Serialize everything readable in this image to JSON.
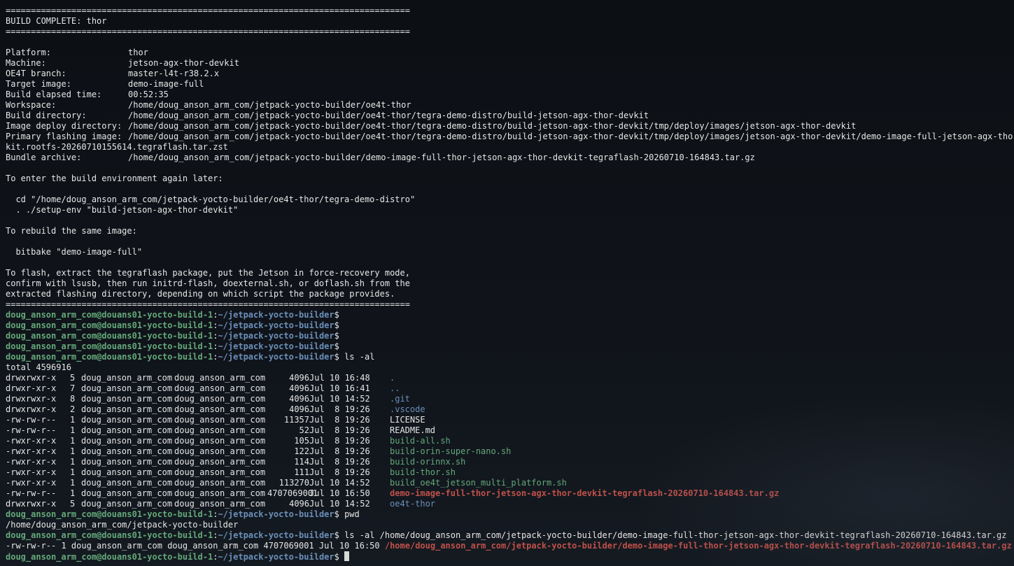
{
  "separator": "================================================================================",
  "build_title": "BUILD COMPLETE: thor",
  "summary": [
    {
      "label": "Platform:",
      "value": "thor"
    },
    {
      "label": "Machine:",
      "value": "jetson-agx-thor-devkit"
    },
    {
      "label": "OE4T branch:",
      "value": "master-l4t-r38.2.x"
    },
    {
      "label": "Target image:",
      "value": "demo-image-full"
    },
    {
      "label": "Build elapsed time:",
      "value": "00:52:35"
    },
    {
      "label": "Workspace:",
      "value": "/home/doug_anson_arm_com/jetpack-yocto-builder/oe4t-thor"
    },
    {
      "label": "Build directory:",
      "value": "/home/doug_anson_arm_com/jetpack-yocto-builder/oe4t-thor/tegra-demo-distro/build-jetson-agx-thor-devkit"
    },
    {
      "label": "Image deploy directory:",
      "value": "/home/doug_anson_arm_com/jetpack-yocto-builder/oe4t-thor/tegra-demo-distro/build-jetson-agx-thor-devkit/tmp/deploy/images/jetson-agx-thor-devkit"
    },
    {
      "label": "Primary flashing image:",
      "value": "/home/doug_anson_arm_com/jetpack-yocto-builder/oe4t-thor/tegra-demo-distro/build-jetson-agx-thor-devkit/tmp/deploy/images/jetson-agx-thor-devkit/demo-image-full-jetson-agx-thor-dev"
    },
    {
      "label": "",
      "value": "kit.rootfs-20260710155614.tegraflash.tar.zst",
      "continuation": true
    },
    {
      "label": "Bundle archive:",
      "value": "/home/doug_anson_arm_com/jetpack-yocto-builder/demo-image-full-thor-jetson-agx-thor-devkit-tegraflash-20260710-164843.tar.gz"
    }
  ],
  "reenter_heading": "To enter the build environment again later:",
  "reenter_cmd1": "  cd \"/home/doug_anson_arm_com/jetpack-yocto-builder/oe4t-thor/tegra-demo-distro\"",
  "reenter_cmd2": "  . ./setup-env \"build-jetson-agx-thor-devkit\"",
  "rebuild_heading": "To rebuild the same image:",
  "rebuild_cmd": "  bitbake \"demo-image-full\"",
  "flash_text": [
    "To flash, extract the tegraflash package, put the Jetson in force-recovery mode,",
    "confirm with lsusb, then run initrd-flash, doexternal.sh, or doflash.sh from the",
    "extracted flashing directory, depending on which script the package provides."
  ],
  "prompt": {
    "user_host": "doug_anson_arm_com@douans01-yocto-build-1",
    "cwd": "~/jetpack-yocto-builder",
    "symbol": "$"
  },
  "ls_cmd": " ls -al",
  "ls_total": "total 4596916",
  "ls_rows": [
    {
      "perms": "drwxrwxr-x",
      "links": "5",
      "owner": "doug_anson_arm_com",
      "group": "doug_anson_arm_com",
      "size": "4096",
      "date": "Jul 10 16:48",
      "name": ".",
      "kind": "dir"
    },
    {
      "perms": "drwxr-xr-x",
      "links": "7",
      "owner": "doug_anson_arm_com",
      "group": "doug_anson_arm_com",
      "size": "4096",
      "date": "Jul 10 16:41",
      "name": "..",
      "kind": "dir"
    },
    {
      "perms": "drwxrwxr-x",
      "links": "8",
      "owner": "doug_anson_arm_com",
      "group": "doug_anson_arm_com",
      "size": "4096",
      "date": "Jul 10 14:52",
      "name": ".git",
      "kind": "dir"
    },
    {
      "perms": "drwxrwxr-x",
      "links": "2",
      "owner": "doug_anson_arm_com",
      "group": "doug_anson_arm_com",
      "size": "4096",
      "date": "Jul  8 19:26",
      "name": ".vscode",
      "kind": "dir"
    },
    {
      "perms": "-rw-rw-r--",
      "links": "1",
      "owner": "doug_anson_arm_com",
      "group": "doug_anson_arm_com",
      "size": "11357",
      "date": "Jul  8 19:26",
      "name": "LICENSE",
      "kind": "file"
    },
    {
      "perms": "-rw-rw-r--",
      "links": "1",
      "owner": "doug_anson_arm_com",
      "group": "doug_anson_arm_com",
      "size": "52",
      "date": "Jul  8 19:26",
      "name": "README.md",
      "kind": "file"
    },
    {
      "perms": "-rwxr-xr-x",
      "links": "1",
      "owner": "doug_anson_arm_com",
      "group": "doug_anson_arm_com",
      "size": "105",
      "date": "Jul  8 19:26",
      "name": "build-all.sh",
      "kind": "exe"
    },
    {
      "perms": "-rwxr-xr-x",
      "links": "1",
      "owner": "doug_anson_arm_com",
      "group": "doug_anson_arm_com",
      "size": "122",
      "date": "Jul  8 19:26",
      "name": "build-orin-super-nano.sh",
      "kind": "exe"
    },
    {
      "perms": "-rwxr-xr-x",
      "links": "1",
      "owner": "doug_anson_arm_com",
      "group": "doug_anson_arm_com",
      "size": "114",
      "date": "Jul  8 19:26",
      "name": "build-orinnx.sh",
      "kind": "exe"
    },
    {
      "perms": "-rwxr-xr-x",
      "links": "1",
      "owner": "doug_anson_arm_com",
      "group": "doug_anson_arm_com",
      "size": "111",
      "date": "Jul  8 19:26",
      "name": "build-thor.sh",
      "kind": "exe"
    },
    {
      "perms": "-rwxr-xr-x",
      "links": "1",
      "owner": "doug_anson_arm_com",
      "group": "doug_anson_arm_com",
      "size": "113270",
      "date": "Jul 10 14:52",
      "name": "build_oe4t_jetson_multi_platform.sh",
      "kind": "exe"
    },
    {
      "perms": "-rw-rw-r--",
      "links": "1",
      "owner": "doug_anson_arm_com",
      "group": "doug_anson_arm_com",
      "size": "4707069001",
      "date": "Jul 10 16:50",
      "name": "demo-image-full-thor-jetson-agx-thor-devkit-tegraflash-20260710-164843.tar.gz",
      "kind": "archive"
    },
    {
      "perms": "drwxrwxr-x",
      "links": "5",
      "owner": "doug_anson_arm_com",
      "group": "doug_anson_arm_com",
      "size": "4096",
      "date": "Jul 10 14:52",
      "name": "oe4t-thor",
      "kind": "dir"
    }
  ],
  "pwd_cmd": " pwd",
  "pwd_output": "/home/doug_anson_arm_com/jetpack-yocto-builder",
  "ls2_cmd": " ls -al /home/doug_anson_arm_com/jetpack-yocto-builder/demo-image-full-thor-jetson-agx-thor-devkit-tegraflash-20260710-164843.tar.gz",
  "ls2_row": {
    "prefix": "-rw-rw-r-- 1 doug_anson_arm_com doug_anson_arm_com 4707069001 Jul 10 16:50 ",
    "name": "/home/doug_anson_arm_com/jetpack-yocto-builder/demo-image-full-thor-jetson-agx-thor-devkit-tegraflash-20260710-164843.tar.gz"
  },
  "colors": {
    "prompt_green": "#64a87a",
    "path_blue": "#6b8fb8",
    "archive_red": "#c0504a",
    "text": "#e6e6e6",
    "background": "#0e1116"
  }
}
